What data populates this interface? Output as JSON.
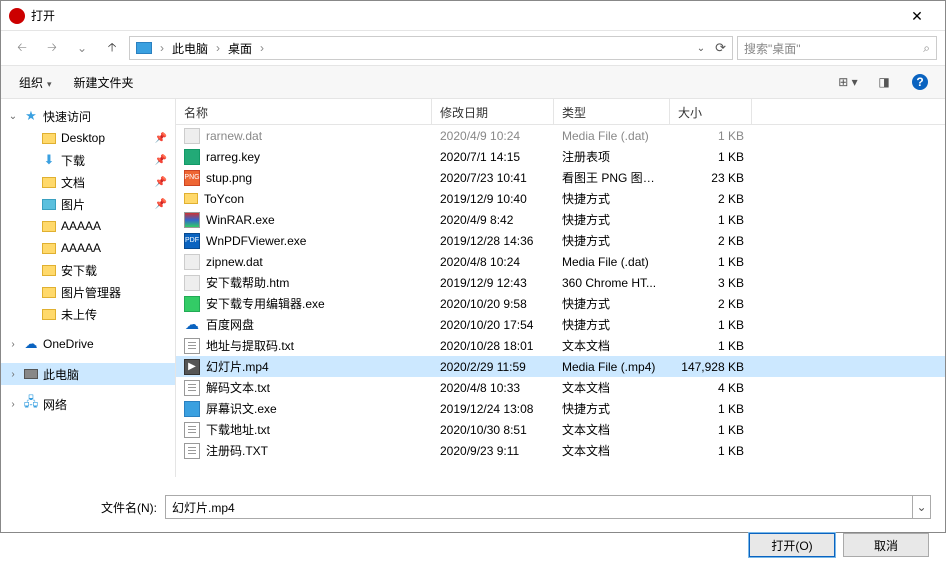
{
  "title": "打开",
  "breadcrumb": {
    "items": [
      "此电脑",
      "桌面"
    ]
  },
  "search": {
    "placeholder": "搜索\"桌面\""
  },
  "toolbar": {
    "organize": "组织",
    "new_folder": "新建文件夹"
  },
  "sidebar": {
    "quick": "快速访问",
    "desktop": "Desktop",
    "downloads": "下载",
    "documents": "文档",
    "pictures": "图片",
    "aaaaa1": "AAAAA",
    "aaaaa2": "AAAAA",
    "anxz": "安下载",
    "picmgr": "图片管理器",
    "unsent": "未上传",
    "onedrive": "OneDrive",
    "thispc": "此电脑",
    "network": "网络"
  },
  "columns": {
    "name": "名称",
    "date": "修改日期",
    "type": "类型",
    "size": "大小"
  },
  "files": [
    {
      "name": "rarnew.dat",
      "date": "2020/4/9 10:24",
      "type": "Media File (.dat)",
      "size": "1 KB",
      "ico": "fi-dat",
      "dim": true
    },
    {
      "name": "rarreg.key",
      "date": "2020/7/1 14:15",
      "type": "注册表项",
      "size": "1 KB",
      "ico": "fi-key"
    },
    {
      "name": "stup.png",
      "date": "2020/7/23 10:41",
      "type": "看图王 PNG 图片...",
      "size": "23 KB",
      "ico": "fi-png"
    },
    {
      "name": "ToYcon",
      "date": "2019/12/9 10:40",
      "type": "快捷方式",
      "size": "2 KB",
      "ico": "fi-fldr"
    },
    {
      "name": "WinRAR.exe",
      "date": "2020/4/9 8:42",
      "type": "快捷方式",
      "size": "1 KB",
      "ico": "fi-exe-r"
    },
    {
      "name": "WnPDFViewer.exe",
      "date": "2019/12/28 14:36",
      "type": "快捷方式",
      "size": "2 KB",
      "ico": "fi-pdf"
    },
    {
      "name": "zipnew.dat",
      "date": "2020/4/8 10:24",
      "type": "Media File (.dat)",
      "size": "1 KB",
      "ico": "fi-dat"
    },
    {
      "name": "安下载帮助.htm",
      "date": "2019/12/9 12:43",
      "type": "360 Chrome HT...",
      "size": "3 KB",
      "ico": "fi-htm"
    },
    {
      "name": "安下载专用编辑器.exe",
      "date": "2020/10/20 9:58",
      "type": "快捷方式",
      "size": "2 KB",
      "ico": "fi-exe-g"
    },
    {
      "name": "百度网盘",
      "date": "2020/10/20 17:54",
      "type": "快捷方式",
      "size": "1 KB",
      "ico": "fi-cloud"
    },
    {
      "name": "地址与提取码.txt",
      "date": "2020/10/28 18:01",
      "type": "文本文档",
      "size": "1 KB",
      "ico": "fi-txt"
    },
    {
      "name": "幻灯片.mp4",
      "date": "2020/2/29 11:59",
      "type": "Media File (.mp4)",
      "size": "147,928 KB",
      "ico": "fi-vid",
      "selected": true
    },
    {
      "name": "解码文本.txt",
      "date": "2020/4/8 10:33",
      "type": "文本文档",
      "size": "4 KB",
      "ico": "fi-txt"
    },
    {
      "name": "屏幕识文.exe",
      "date": "2019/12/24 13:08",
      "type": "快捷方式",
      "size": "1 KB",
      "ico": "fi-exe-b"
    },
    {
      "name": "下载地址.txt",
      "date": "2020/10/30 8:51",
      "type": "文本文档",
      "size": "1 KB",
      "ico": "fi-txt"
    },
    {
      "name": "注册码.TXT",
      "date": "2020/9/23 9:11",
      "type": "文本文档",
      "size": "1 KB",
      "ico": "fi-txt"
    }
  ],
  "filename": {
    "label": "文件名(N):",
    "value": "幻灯片.mp4"
  },
  "buttons": {
    "open": "打开(O)",
    "cancel": "取消"
  }
}
